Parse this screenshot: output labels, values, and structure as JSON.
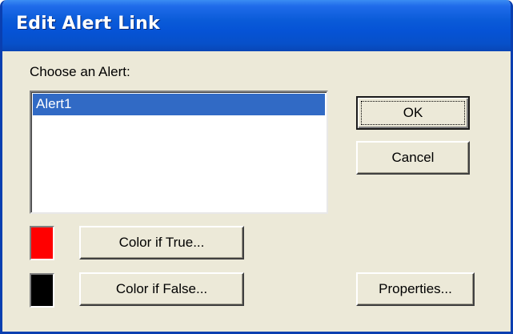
{
  "window": {
    "title": "Edit Alert Link"
  },
  "dialog": {
    "choose_label": "Choose an Alert:",
    "alerts": [
      {
        "label": "Alert1",
        "selected": true
      }
    ],
    "ok_label": "OK",
    "cancel_label": "Cancel",
    "color_true_label": "Color if True...",
    "color_false_label": "Color if False...",
    "properties_label": "Properties...",
    "true_color": "#ff0000",
    "false_color": "#000000"
  },
  "colors": {
    "titlebar": "#0653d6",
    "dialog_bg": "#ece9d8",
    "selection": "#316ac5"
  }
}
